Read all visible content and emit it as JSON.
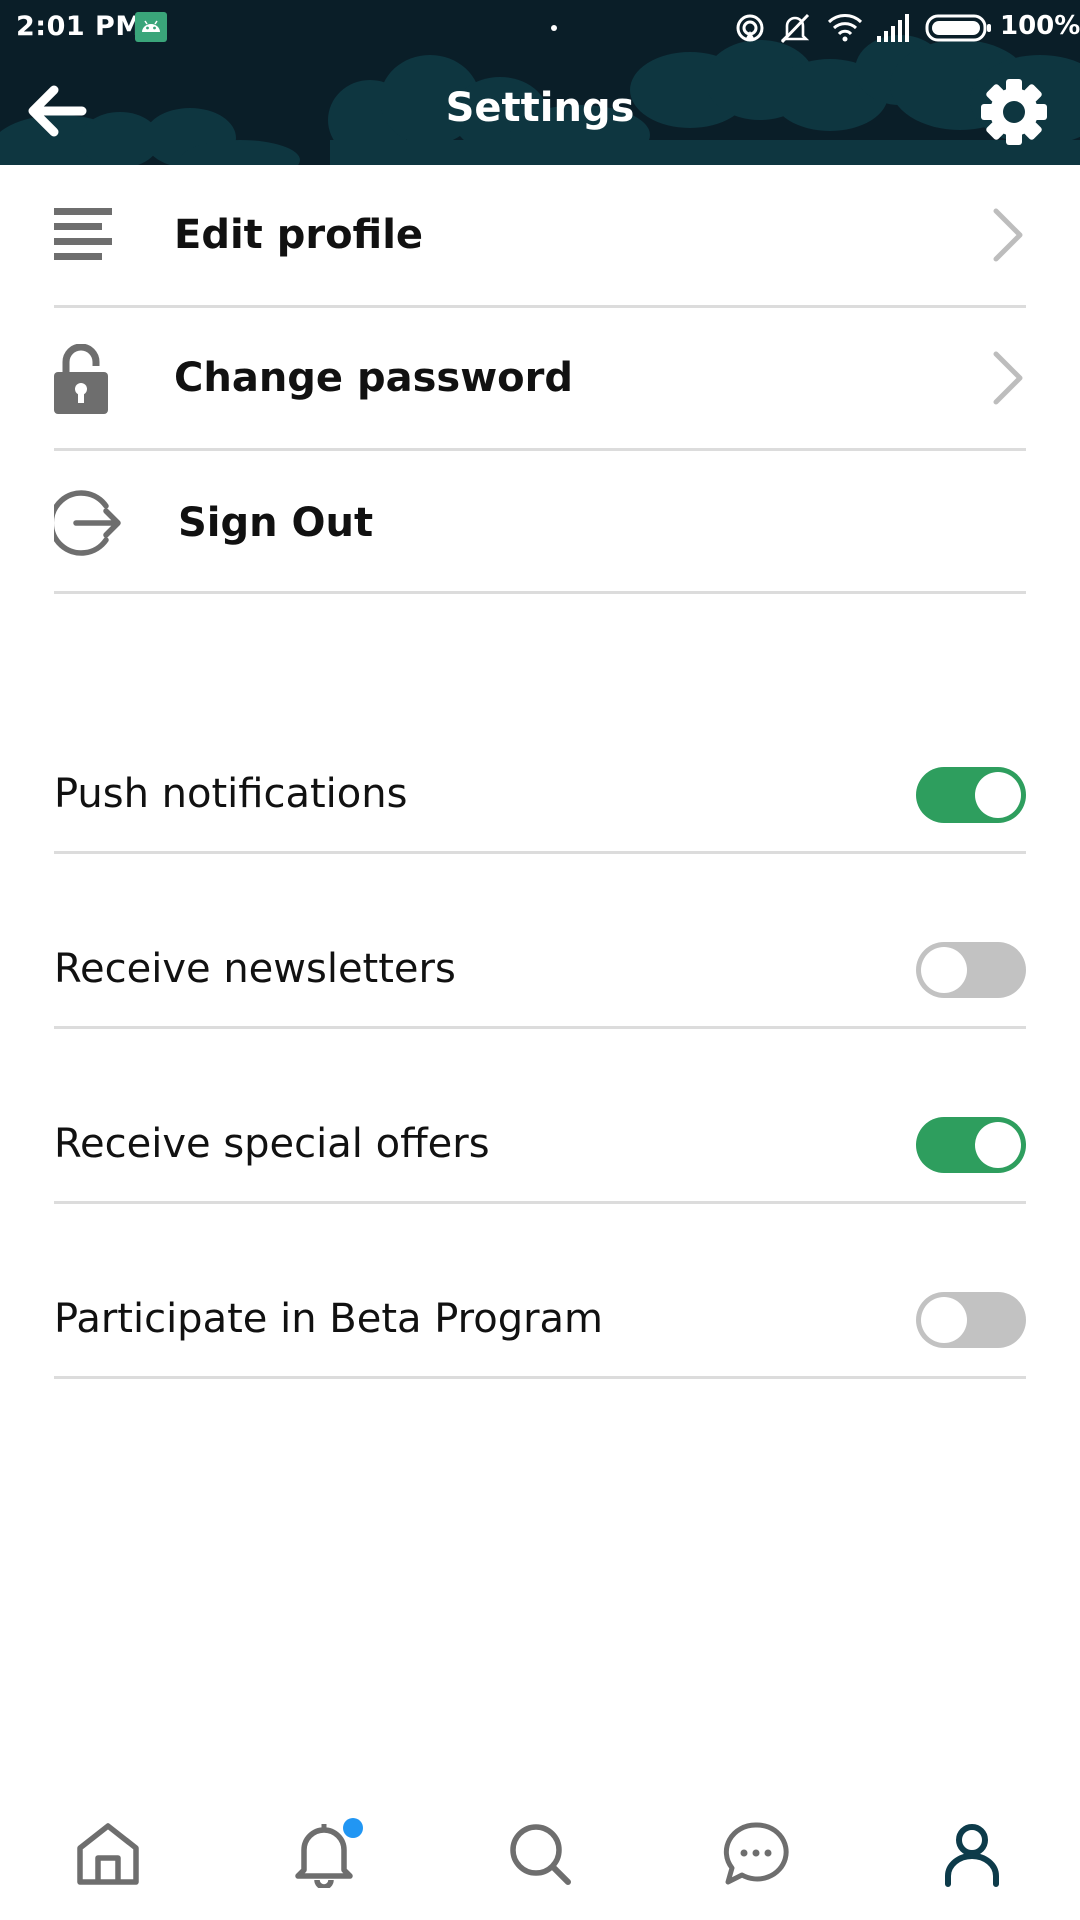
{
  "status_bar": {
    "time": "2:01 PM",
    "battery": "100%",
    "icons": [
      "android-debug-icon",
      "hotspot-icon",
      "mute-icon",
      "wifi-icon",
      "signal-icon",
      "battery-icon"
    ]
  },
  "toolbar": {
    "title": "Settings",
    "back_icon": "back-arrow-icon",
    "settings_icon": "gear-icon"
  },
  "menu": [
    {
      "label": "Edit profile",
      "icon": "lines-icon",
      "has_chevron": true
    },
    {
      "label": "Change password",
      "icon": "lock-icon",
      "has_chevron": true
    },
    {
      "label": "Sign Out",
      "icon": "sign-out-icon",
      "has_chevron": false
    }
  ],
  "toggles": [
    {
      "label": "Push notifications",
      "on": true
    },
    {
      "label": "Receive newsletters",
      "on": false
    },
    {
      "label": "Receive special offers",
      "on": true
    },
    {
      "label": "Participate in Beta Program",
      "on": false
    }
  ],
  "bottom_nav": [
    {
      "name": "home",
      "icon": "home-icon"
    },
    {
      "name": "notifications",
      "icon": "bell-icon",
      "badge": true
    },
    {
      "name": "search",
      "icon": "search-icon"
    },
    {
      "name": "messages",
      "icon": "chat-icon"
    },
    {
      "name": "profile",
      "icon": "user-icon",
      "active": true
    }
  ],
  "colors": {
    "header_bg": "#0a1e28",
    "cloud": "#0e3640",
    "toggle_on": "#2e9e5e",
    "toggle_off": "#c2c2c2",
    "divider": "#dcdcdc",
    "icon_gray": "#6e6e6e",
    "active_nav": "#0d3b4a",
    "badge": "#2196f3"
  }
}
